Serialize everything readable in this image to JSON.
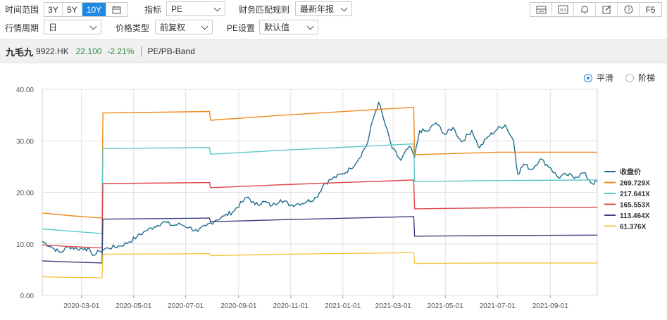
{
  "controls": {
    "time_range_label": "时间范围",
    "range_buttons": [
      "3Y",
      "5Y",
      "10Y"
    ],
    "range_active": "10Y",
    "indicator_label": "指标",
    "indicator_value": "PE",
    "fin_rule_label": "财务匹配规则",
    "fin_rule_value": "最新年报",
    "period_label": "行情周期",
    "period_value": "日",
    "price_type_label": "价格类型",
    "price_type_value": "前复权",
    "pe_setting_label": "PE设置",
    "pe_setting_value": "默认值",
    "toolbar_f5": "F5"
  },
  "stock": {
    "name": "九毛九",
    "code": "9922.HK",
    "price": "22.100",
    "change": "-2.21%",
    "chart_title": "PE/PB-Band"
  },
  "mode": {
    "smooth_label": "平滑",
    "step_label": "阶梯",
    "selected": "smooth"
  },
  "colors": {
    "close": "#1f6e8f",
    "band1": "#f08a1e",
    "band2": "#5cc9c6",
    "band3": "#e0474c",
    "band4": "#3b3f7e",
    "band5": "#f4c542",
    "accent": "#1e88e5",
    "grid": "#e2e2e2"
  },
  "chart_data": {
    "type": "line",
    "x_ticks": [
      "2020-03-01",
      "2020-05-01",
      "2020-07-01",
      "2020-09-01",
      "2020-11-01",
      "2021-01-01",
      "2021-03-01",
      "2021-05-01",
      "2021-07-01",
      "2021-09-01"
    ],
    "y_ticks": [
      "0.00",
      "10.00",
      "20.00",
      "30.00",
      "40.00"
    ],
    "ylim": [
      0,
      40
    ],
    "x_range": [
      "2020-01-15",
      "2021-10-26"
    ],
    "legend_position": "right",
    "series": [
      {
        "name": "收盘价",
        "color_key": "close",
        "points": [
          [
            "2020-01-15",
            10.5
          ],
          [
            "2020-01-25",
            9.5
          ],
          [
            "2020-02-05",
            8.3
          ],
          [
            "2020-02-15",
            9.5
          ],
          [
            "2020-02-25",
            9.0
          ],
          [
            "2020-03-05",
            9.2
          ],
          [
            "2020-03-12",
            8.4
          ],
          [
            "2020-03-16",
            7.8
          ],
          [
            "2020-03-22",
            8.6
          ],
          [
            "2020-04-01",
            9.2
          ],
          [
            "2020-04-15",
            9.6
          ],
          [
            "2020-04-25",
            10.3
          ],
          [
            "2020-05-05",
            11.4
          ],
          [
            "2020-05-15",
            12.5
          ],
          [
            "2020-05-25",
            13.3
          ],
          [
            "2020-06-05",
            14.3
          ],
          [
            "2020-06-15",
            13.6
          ],
          [
            "2020-06-25",
            13.8
          ],
          [
            "2020-07-05",
            13.2
          ],
          [
            "2020-07-15",
            12.4
          ],
          [
            "2020-07-25",
            13.5
          ],
          [
            "2020-08-05",
            14.6
          ],
          [
            "2020-08-15",
            15.4
          ],
          [
            "2020-08-25",
            16.2
          ],
          [
            "2020-09-05",
            18.1
          ],
          [
            "2020-09-12",
            19.1
          ],
          [
            "2020-09-20",
            17.6
          ],
          [
            "2020-10-01",
            18.2
          ],
          [
            "2020-10-10",
            17.4
          ],
          [
            "2020-10-20",
            18.6
          ],
          [
            "2020-11-01",
            17.5
          ],
          [
            "2020-11-10",
            17.8
          ],
          [
            "2020-11-20",
            18.2
          ],
          [
            "2020-12-01",
            19.0
          ],
          [
            "2020-12-10",
            21.6
          ],
          [
            "2020-12-20",
            22.7
          ],
          [
            "2021-01-01",
            23.6
          ],
          [
            "2021-01-10",
            24.6
          ],
          [
            "2021-01-20",
            26.6
          ],
          [
            "2021-01-30",
            29.6
          ],
          [
            "2021-02-05",
            34.0
          ],
          [
            "2021-02-12",
            37.5
          ],
          [
            "2021-02-20",
            33.0
          ],
          [
            "2021-02-28",
            28.5
          ],
          [
            "2021-03-10",
            26.2
          ],
          [
            "2021-03-20",
            29.0
          ],
          [
            "2021-03-26",
            26.8
          ],
          [
            "2021-04-01",
            32.0
          ],
          [
            "2021-04-10",
            31.8
          ],
          [
            "2021-04-20",
            33.5
          ],
          [
            "2021-05-01",
            31.2
          ],
          [
            "2021-05-10",
            32.6
          ],
          [
            "2021-05-20",
            29.8
          ],
          [
            "2021-06-01",
            32.0
          ],
          [
            "2021-06-10",
            28.6
          ],
          [
            "2021-06-20",
            30.8
          ],
          [
            "2021-07-01",
            32.3
          ],
          [
            "2021-07-10",
            33.1
          ],
          [
            "2021-07-20",
            30.0
          ],
          [
            "2021-07-25",
            23.5
          ],
          [
            "2021-08-01",
            25.5
          ],
          [
            "2021-08-10",
            24.4
          ],
          [
            "2021-08-20",
            26.5
          ],
          [
            "2021-09-01",
            24.8
          ],
          [
            "2021-09-10",
            22.9
          ],
          [
            "2021-09-20",
            23.4
          ],
          [
            "2021-10-01",
            23.0
          ],
          [
            "2021-10-10",
            23.8
          ],
          [
            "2021-10-20",
            21.7
          ],
          [
            "2021-10-26",
            22.1
          ]
        ]
      },
      {
        "name": "269.729X",
        "color_key": "band1",
        "points": [
          [
            "2020-01-15",
            16.0
          ],
          [
            "2020-02-15",
            15.5
          ],
          [
            "2020-03-25",
            15.0
          ],
          [
            "2020-03-26",
            35.4
          ],
          [
            "2020-07-29",
            35.7
          ],
          [
            "2020-07-30",
            34.0
          ],
          [
            "2020-10-25",
            35.0
          ],
          [
            "2021-03-25",
            36.5
          ],
          [
            "2021-03-26",
            27.3
          ],
          [
            "2021-07-01",
            27.8
          ],
          [
            "2021-10-26",
            27.8
          ]
        ]
      },
      {
        "name": "217.641X",
        "color_key": "band2",
        "points": [
          [
            "2020-01-15",
            12.9
          ],
          [
            "2020-02-15",
            12.5
          ],
          [
            "2020-03-25",
            12.0
          ],
          [
            "2020-03-26",
            28.5
          ],
          [
            "2020-07-29",
            28.7
          ],
          [
            "2020-07-30",
            27.4
          ],
          [
            "2020-10-25",
            28.2
          ],
          [
            "2021-03-25",
            29.4
          ],
          [
            "2021-03-26",
            22.1
          ],
          [
            "2021-07-01",
            22.3
          ],
          [
            "2021-10-26",
            22.4
          ]
        ]
      },
      {
        "name": "165.553X",
        "color_key": "band3",
        "points": [
          [
            "2020-01-15",
            9.8
          ],
          [
            "2020-02-15",
            9.5
          ],
          [
            "2020-03-25",
            9.2
          ],
          [
            "2020-03-26",
            21.7
          ],
          [
            "2020-07-29",
            21.9
          ],
          [
            "2020-07-30",
            20.9
          ],
          [
            "2020-10-25",
            21.5
          ],
          [
            "2021-03-25",
            22.4
          ],
          [
            "2021-03-26",
            16.8
          ],
          [
            "2021-07-01",
            17.0
          ],
          [
            "2021-10-26",
            17.1
          ]
        ]
      },
      {
        "name": "113.464X",
        "color_key": "band4",
        "points": [
          [
            "2020-01-15",
            6.7
          ],
          [
            "2020-02-15",
            6.5
          ],
          [
            "2020-03-25",
            6.3
          ],
          [
            "2020-03-26",
            14.8
          ],
          [
            "2020-07-29",
            15.0
          ],
          [
            "2020-07-30",
            14.3
          ],
          [
            "2020-10-25",
            14.7
          ],
          [
            "2021-03-25",
            15.3
          ],
          [
            "2021-03-26",
            11.5
          ],
          [
            "2021-07-01",
            11.6
          ],
          [
            "2021-10-26",
            11.7
          ]
        ]
      },
      {
        "name": "61.376X",
        "color_key": "band5",
        "points": [
          [
            "2020-01-15",
            3.6
          ],
          [
            "2020-02-15",
            3.5
          ],
          [
            "2020-03-25",
            3.4
          ],
          [
            "2020-03-26",
            8.0
          ],
          [
            "2020-07-29",
            8.1
          ],
          [
            "2020-07-30",
            7.7
          ],
          [
            "2020-10-25",
            8.0
          ],
          [
            "2021-03-25",
            8.3
          ],
          [
            "2021-03-26",
            6.2
          ],
          [
            "2021-07-01",
            6.3
          ],
          [
            "2021-10-26",
            6.3
          ]
        ]
      }
    ]
  }
}
